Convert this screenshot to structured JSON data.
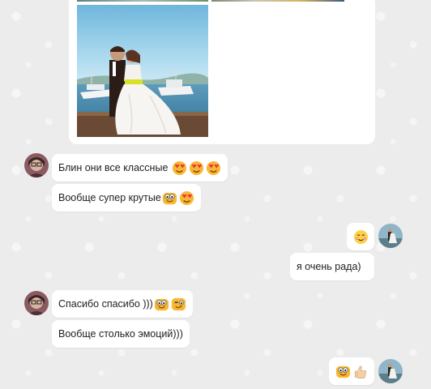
{
  "messages": [
    {
      "id": "m1",
      "text": "Блин они все классные",
      "emojis": [
        "heart-eyes-icon",
        "heart-eyes-icon",
        "heart-eyes-icon"
      ]
    },
    {
      "id": "m2",
      "text": "Вообще супер крутые",
      "emojis": [
        "bubble-eyes-icon",
        "heart-eyes-icon"
      ]
    },
    {
      "id": "m3",
      "text": "",
      "emojis": [
        "blushing-smile-icon"
      ]
    },
    {
      "id": "m4",
      "text": "я очень рада)",
      "emojis": []
    },
    {
      "id": "m5",
      "text": "Спасибо спасибо )))",
      "emojis": [
        "bubble-eyes-icon",
        "winking-icon"
      ]
    },
    {
      "id": "m6",
      "text": "Вообще столько эмоций)))",
      "emojis": []
    },
    {
      "id": "m7",
      "text": "",
      "emojis": [
        "bubble-eyes-icon",
        "thumbs-up-icon"
      ]
    }
  ],
  "colors": {
    "background": "#ececec",
    "bubble": "#ffffff",
    "emoji_face": "#f7b733"
  }
}
